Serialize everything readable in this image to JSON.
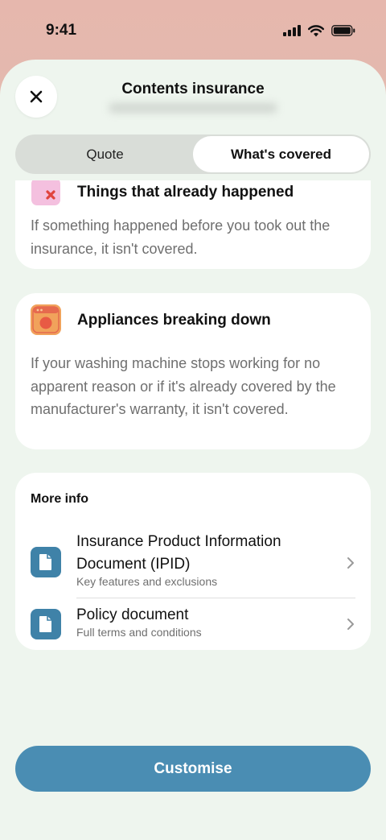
{
  "status_bar": {
    "time": "9:41"
  },
  "header": {
    "title": "Contents insurance"
  },
  "tabs": [
    {
      "label": "Quote",
      "active": false
    },
    {
      "label": "What's covered",
      "active": true
    }
  ],
  "exclusions": [
    {
      "heading": "Things that already happened",
      "body": "If something happened before you took out the insurance, it isn't covered.",
      "icon": "calendar-cross-icon"
    },
    {
      "heading": "Appliances breaking down",
      "body": "If your washing machine stops working for no apparent reason or if it's already covered by the manufacturer's warranty, it isn't covered.",
      "icon": "washing-machine-icon"
    }
  ],
  "more_info": {
    "title": "More info",
    "documents": [
      {
        "title": "Insurance Product Information Document (IPID)",
        "subtitle": "Key features and exclusions",
        "icon": "document-icon"
      },
      {
        "title": "Policy document",
        "subtitle": "Full terms and conditions",
        "icon": "document-icon"
      }
    ]
  },
  "cta": {
    "label": "Customise"
  },
  "colors": {
    "accent": "#4a8db3",
    "doc_icon": "#3f82a8",
    "sheet_bg": "#eef5ee",
    "appliance_icon": "#f1a25b"
  }
}
